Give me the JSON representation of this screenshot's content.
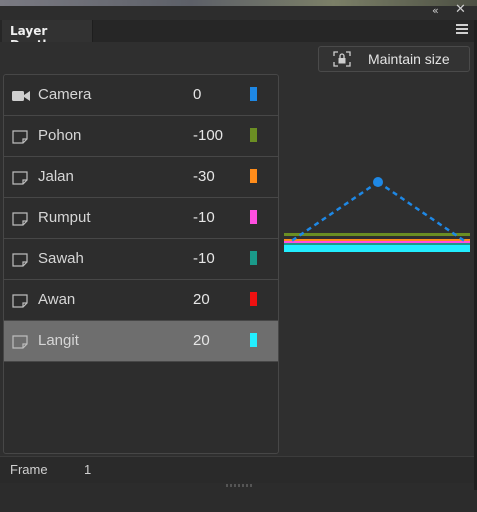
{
  "window": {
    "tab_title": "Layer Depth",
    "collapse_icon": "«",
    "close_icon": "✕"
  },
  "toolbar": {
    "maintain_size_label": "Maintain size"
  },
  "layers": [
    {
      "name": "Camera",
      "depth": "0",
      "color": "#1e88e5",
      "icon": "camera-icon"
    },
    {
      "name": "Pohon",
      "depth": "-100",
      "color": "#6b8e23",
      "icon": "layer-icon"
    },
    {
      "name": "Jalan",
      "depth": "-30",
      "color": "#ff8c1a",
      "icon": "layer-icon"
    },
    {
      "name": "Rumput",
      "depth": "-10",
      "color": "#ff4fe0",
      "icon": "layer-icon"
    },
    {
      "name": "Sawah",
      "depth": "-10",
      "color": "#1a9a8a",
      "icon": "layer-icon"
    },
    {
      "name": "Awan",
      "depth": "20",
      "color": "#ee1111",
      "icon": "layer-icon"
    },
    {
      "name": "Langit",
      "depth": "20",
      "color": "#22eeff",
      "icon": "layer-icon",
      "selected": true
    }
  ],
  "footer": {
    "frame_label": "Frame",
    "frame_value": "1"
  },
  "colors": {
    "accent": "#1e88e5",
    "selected_row": "#6e6e6e"
  }
}
